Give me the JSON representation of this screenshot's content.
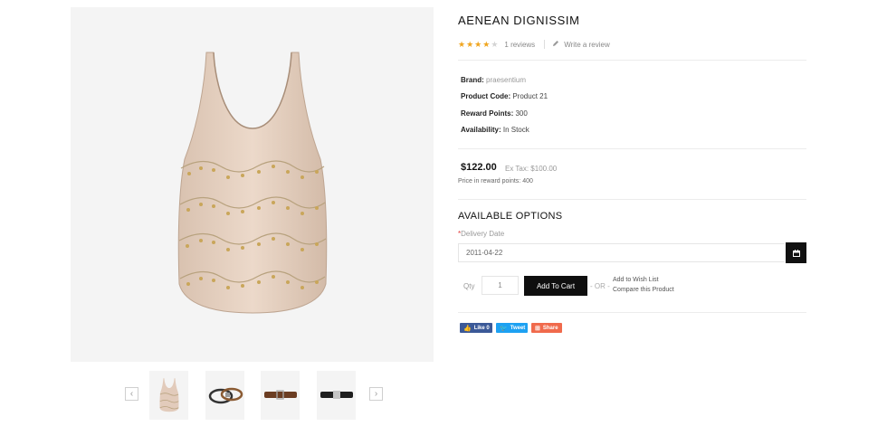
{
  "product": {
    "title": "AENEAN DIGNISSIM",
    "rating": 4,
    "rating_max": 5,
    "reviews_link": "1 reviews",
    "write_review_link": "Write a review"
  },
  "details": [
    {
      "label": "Brand:",
      "value": "praesentium"
    },
    {
      "label": "Product Code:",
      "value": "Product 21"
    },
    {
      "label": "Reward Points:",
      "value": "300"
    },
    {
      "label": "Availability:",
      "value": "In Stock"
    }
  ],
  "pricing": {
    "price": "$122.00",
    "ex_tax": "Ex Tax: $100.00",
    "reward_price": "Price in reward points: 400"
  },
  "options": {
    "heading": "AVAILABLE OPTIONS",
    "delivery_label": "Delivery Date",
    "required_mark": "*",
    "delivery_value": "2011-04-22"
  },
  "purchase": {
    "qty_label": "Qty",
    "qty_value": "1",
    "cart_label": "Add To Cart",
    "or_text": "- OR -",
    "wishlist_link": "Add to Wish List",
    "compare_link": "Compare this Product"
  },
  "share": [
    {
      "label": "Like 0",
      "icon": "thumbs-up-icon",
      "color": "#3b5998"
    },
    {
      "label": "Tweet",
      "icon": "twitter-icon",
      "color": "#1da1f2"
    },
    {
      "label": "Share",
      "icon": "plus-icon",
      "color": "#f06a4c"
    }
  ],
  "colors": {
    "star_on": "#f0a51e",
    "star_off": "#d4d4d4",
    "button": "#0f0f0f"
  },
  "gallery": {
    "thumbnails": [
      "tank-top",
      "belt-braided",
      "belt-leather-brown",
      "belt-leather-black"
    ]
  }
}
